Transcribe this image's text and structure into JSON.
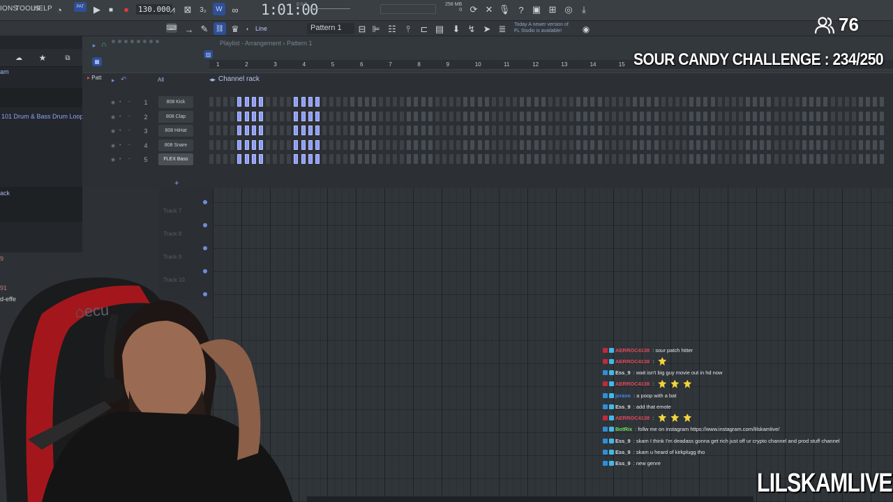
{
  "menu": [
    "IONS",
    "TOOLS",
    "HELP"
  ],
  "transport": {
    "tempo": "130.000",
    "time": "1:01:00",
    "time_label": "B:S:T"
  },
  "memory": {
    "line1": "258 MB",
    "line2": "0"
  },
  "snap": {
    "label": "Line"
  },
  "pattern_selector": {
    "label": "Pattern 1"
  },
  "news": {
    "line1": "Today  A newer version of",
    "line2": "FL Studio is available!"
  },
  "playlist": {
    "breadcrumb": "Playlist - Arrangement  ›  Pattern 1",
    "ruler": [
      "1",
      "2",
      "3",
      "4",
      "5",
      "6",
      "7",
      "8",
      "9",
      "10",
      "11",
      "12",
      "13",
      "14",
      "15"
    ]
  },
  "browser": {
    "pattern_label": "Patt",
    "item_all": "All",
    "item1": "am",
    "item2": "101 Drum & Bass Drum Loops",
    "item3": "ack",
    "item4": "9",
    "item5": "91",
    "item6": "d-effe"
  },
  "channel_rack": {
    "title": "Channel rack",
    "filter": "All",
    "channels": [
      {
        "num": "1",
        "name": "808 Kick"
      },
      {
        "num": "2",
        "name": "808 Clap"
      },
      {
        "num": "3",
        "name": "808 HiHat"
      },
      {
        "num": "4",
        "name": "808 Snare"
      },
      {
        "num": "5",
        "name": "FLEX Bass"
      }
    ],
    "add_label": "+"
  },
  "tracks": [
    "Track 7",
    "Track 8",
    "Track 9",
    "Track 10"
  ],
  "overlay": {
    "viewer_count": "76",
    "challenge": "SOUR CANDY CHALLENGE : 234/250",
    "brand": "LILSKAMLIVE"
  },
  "chat": [
    {
      "user": "AERROC4138",
      "text": ": sour patch hitter",
      "user_color": "#e2485a",
      "emotes": 0
    },
    {
      "user": "AERROC4138",
      "text": ":",
      "user_color": "#e2485a",
      "emotes": 1
    },
    {
      "user": "Ess_9",
      "text": ": wait isn't big guy movie out in hd now",
      "user_color": "#d9dde2",
      "emotes": 0
    },
    {
      "user": "AERROC4138",
      "text": ":",
      "user_color": "#e2485a",
      "emotes": 3
    },
    {
      "user": "jcravo",
      "text": ": a poop with a bat",
      "user_color": "#3d8cf0",
      "emotes": 0
    },
    {
      "user": "Ess_9",
      "text": ": add that emote",
      "user_color": "#d9dde2",
      "emotes": 0
    },
    {
      "user": "AERROC4138",
      "text": ":",
      "user_color": "#e2485a",
      "emotes": 3
    },
    {
      "user": "BotRix",
      "text": ": follw me on instagram https://www.instagram.com/lilskamlive/",
      "user_color": "#73e35a",
      "emotes": 0
    },
    {
      "user": "Ess_9",
      "text": ": skam I think I'm deadass gonna get rich just off ur crypto channel and prod stuff channel",
      "user_color": "#d9dde2",
      "emotes": 0
    },
    {
      "user": "Ess_9",
      "text": ": skam u heard of kirkplugg tho",
      "user_color": "#d9dde2",
      "emotes": 0
    },
    {
      "user": "Ess_9",
      "text": ": new genre",
      "user_color": "#d9dde2",
      "emotes": 0
    }
  ],
  "colors": {
    "step_on": "#8e9cf6",
    "accent": "#2f4f96"
  }
}
